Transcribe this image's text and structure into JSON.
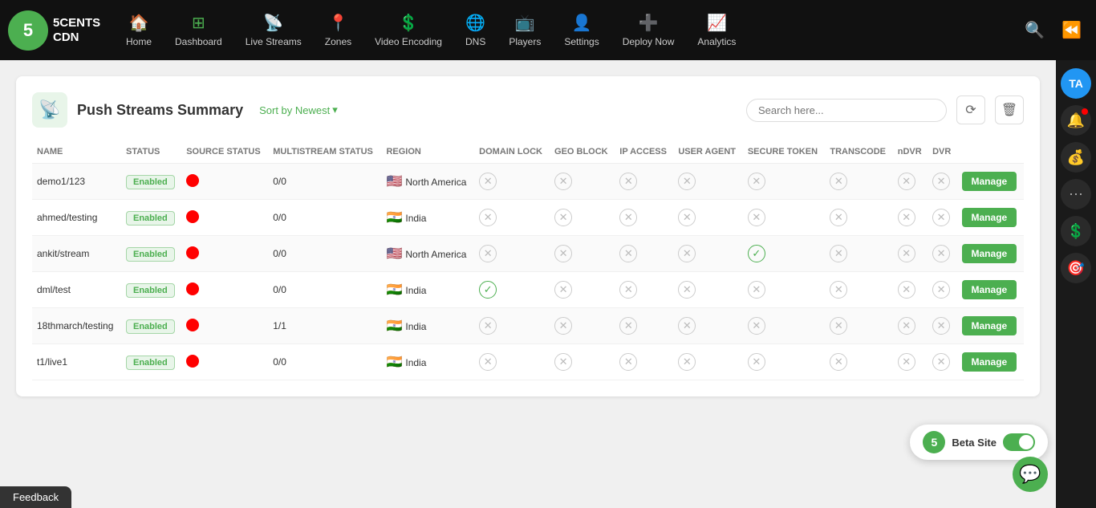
{
  "logo": {
    "number": "5",
    "line1": "5CENTS",
    "line2": "CDN"
  },
  "nav": {
    "items": [
      {
        "id": "home",
        "label": "Home",
        "icon": "🏠"
      },
      {
        "id": "dashboard",
        "label": "Dashboard",
        "icon": "⊞"
      },
      {
        "id": "live-streams",
        "label": "Live Streams",
        "icon": "📡"
      },
      {
        "id": "zones",
        "label": "Zones",
        "icon": "📍"
      },
      {
        "id": "video-encoding",
        "label": "Video Encoding",
        "icon": "💲"
      },
      {
        "id": "dns",
        "label": "DNS",
        "icon": "🌐"
      },
      {
        "id": "players",
        "label": "Players",
        "icon": "📺"
      },
      {
        "id": "settings",
        "label": "Settings",
        "icon": "👤"
      },
      {
        "id": "deploy-now",
        "label": "Deploy Now",
        "icon": "➕"
      },
      {
        "id": "analytics",
        "label": "Analytics",
        "icon": "📈"
      }
    ]
  },
  "sidebar": {
    "avatar_text": "TA",
    "icons": [
      "🔔",
      "💰",
      "⋯",
      "💲",
      "🎯"
    ]
  },
  "page": {
    "title": "Push Streams Summary",
    "sort_label": "Sort by Newest",
    "search_placeholder": "Search here...",
    "columns": [
      "NAME",
      "STATUS",
      "SOURCE STATUS",
      "MULTISTREAM STATUS",
      "REGION",
      "DOMAIN LOCK",
      "GEO BLOCK",
      "IP ACCESS",
      "USER AGENT",
      "SECURE TOKEN",
      "TRANSCODE",
      "nDVR",
      "DVR",
      ""
    ],
    "rows": [
      {
        "name": "demo1/123",
        "status": "Enabled",
        "source_status": "red",
        "multistream": "0/0",
        "region": "North America",
        "flag": "🇺🇸",
        "domain_lock": "x",
        "geo_block": "x",
        "ip_access": "x",
        "user_agent": "x",
        "secure_token": "x",
        "transcode": "x",
        "ndvr": "x",
        "dvr": "x",
        "action": "Manage"
      },
      {
        "name": "ahmed/testing",
        "status": "Enabled",
        "source_status": "red",
        "multistream": "0/0",
        "region": "India",
        "flag": "🇮🇳",
        "domain_lock": "x",
        "geo_block": "x",
        "ip_access": "x",
        "user_agent": "x",
        "secure_token": "x",
        "transcode": "x",
        "ndvr": "x",
        "dvr": "x",
        "action": "Manage"
      },
      {
        "name": "ankit/stream",
        "status": "Enabled",
        "source_status": "red",
        "multistream": "0/0",
        "region": "North America",
        "flag": "🇺🇸",
        "domain_lock": "x",
        "geo_block": "x",
        "ip_access": "x",
        "user_agent": "x",
        "secure_token": "check",
        "transcode": "x",
        "ndvr": "x",
        "dvr": "x",
        "action": "Manage"
      },
      {
        "name": "dml/test",
        "status": "Enabled",
        "source_status": "red",
        "multistream": "0/0",
        "region": "India",
        "flag": "🇮🇳",
        "domain_lock": "check",
        "geo_block": "x",
        "ip_access": "x",
        "user_agent": "x",
        "secure_token": "x",
        "transcode": "x",
        "ndvr": "x",
        "dvr": "x",
        "action": "Manage"
      },
      {
        "name": "18thmarch/testing",
        "status": "Enabled",
        "source_status": "red",
        "multistream": "1/1",
        "region": "India",
        "flag": "🇮🇳",
        "domain_lock": "x",
        "geo_block": "x",
        "ip_access": "x",
        "user_agent": "x",
        "secure_token": "x",
        "transcode": "x",
        "ndvr": "x",
        "dvr": "x",
        "action": "Manage"
      },
      {
        "name": "t1/live1",
        "status": "Enabled",
        "source_status": "red",
        "multistream": "0/0",
        "region": "India",
        "flag": "🇮🇳",
        "domain_lock": "x",
        "geo_block": "x",
        "ip_access": "x",
        "user_agent": "x",
        "secure_token": "x",
        "transcode": "x",
        "ndvr": "x",
        "dvr": "x",
        "action": "Manage"
      }
    ]
  },
  "beta": {
    "logo_text": "5",
    "label": "Beta Site"
  },
  "feedback": {
    "label": "Feedback"
  }
}
